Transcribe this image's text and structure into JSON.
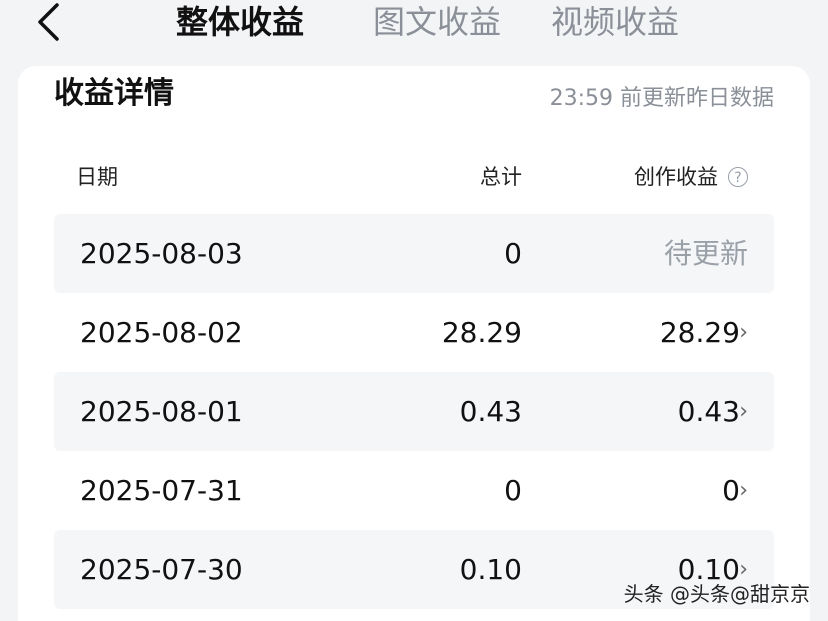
{
  "tabs": [
    {
      "label": "整体收益",
      "active": true
    },
    {
      "label": "图文收益",
      "active": false
    },
    {
      "label": "视频收益",
      "active": false
    }
  ],
  "card": {
    "title": "收益详情",
    "update_note": "23:59 前更新昨日数据"
  },
  "columns": {
    "date": "日期",
    "total": "总计",
    "creation": "创作收益"
  },
  "rows": [
    {
      "date": "2025-08-03",
      "total": "0",
      "creation": "待更新"
    },
    {
      "date": "2025-08-02",
      "total": "28.29",
      "creation": "28.29"
    },
    {
      "date": "2025-08-01",
      "total": "0.43",
      "creation": "0.43"
    },
    {
      "date": "2025-07-31",
      "total": "0",
      "creation": "0"
    },
    {
      "date": "2025-07-30",
      "total": "0.10",
      "creation": "0.10"
    }
  ],
  "watermark": "头条 @头条@甜京京",
  "icons": {
    "back": "back-chevron-icon",
    "help": "help-circle-icon",
    "row_arrow": "chevron-right-icon"
  },
  "colors": {
    "text": "#111111",
    "muted": "#8a8f98",
    "row_shade": "#f5f6f8",
    "bg": "#f3f4f6"
  }
}
